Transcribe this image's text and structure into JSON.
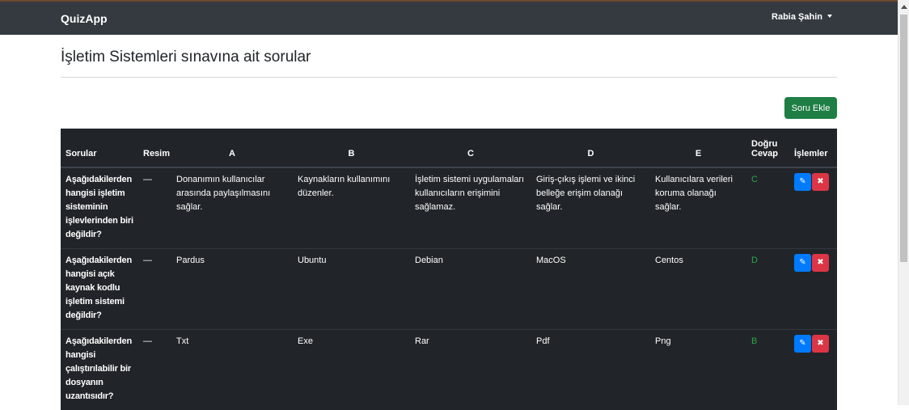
{
  "navbar": {
    "brand": "QuizApp",
    "user_name": "Rabia Şahin"
  },
  "page": {
    "title": "İşletim Sistemleri sınavına ait sorular",
    "add_button": "Soru Ekle"
  },
  "table": {
    "headers": {
      "question": "Sorular",
      "image": "Resim",
      "a": "A",
      "b": "B",
      "c": "C",
      "d": "D",
      "e": "E",
      "correct_line1": "Doğru",
      "correct_line2": "Cevap",
      "actions": "İşlemler"
    },
    "rows": [
      {
        "question": "Aşağıdakilerden hangisi işletim sisteminin işlevlerinden biri değildir?",
        "image": "—",
        "a": "Donanımın kullanıcılar arasında paylaşılmasını sağlar.",
        "b": "Kaynakların kullanımını düzenler.",
        "c": "İşletim sistemi uygulamaları kullanıcıların erişimini sağlamaz.",
        "d": "Giriş-çıkış işlemi ve ikinci belleğe erişim olanağı sağlar.",
        "e": "Kullanıcılara verileri koruma olanağı sağlar.",
        "correct": "C"
      },
      {
        "question": "Aşağıdakilerden hangisi açık kaynak kodlu işletim sistemi değildir?",
        "image": "—",
        "a": "Pardus",
        "b": "Ubuntu",
        "c": "Debian",
        "d": "MacOS",
        "e": "Centos",
        "correct": "D"
      },
      {
        "question": "Aşağıdakilerden hangisi çalıştırılabilir bir dosyanın uzantısıdır?",
        "image": "—",
        "a": "Txt",
        "b": "Exe",
        "c": "Rar",
        "d": "Pdf",
        "e": "Png",
        "correct": "B"
      }
    ]
  },
  "icons": {
    "edit": "pencil-icon",
    "delete": "times-icon"
  },
  "colors": {
    "navbar": "#343a40",
    "add_button": "#1e7e44",
    "edit_button": "#007bff",
    "delete_button": "#dc3545",
    "correct_answer": "#28a745",
    "table_bg": "#212529"
  }
}
